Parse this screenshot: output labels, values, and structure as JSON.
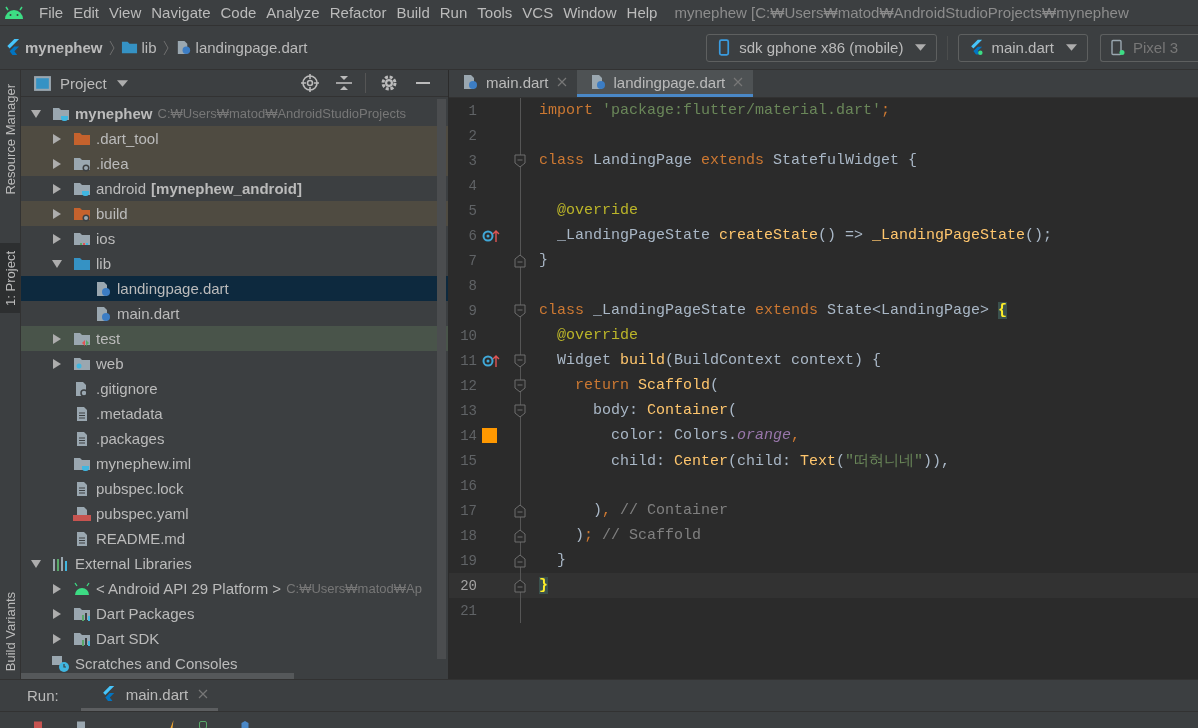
{
  "menu": [
    "File",
    "Edit",
    "View",
    "Navigate",
    "Code",
    "Analyze",
    "Refactor",
    "Build",
    "Run",
    "Tools",
    "VCS",
    "Window",
    "Help"
  ],
  "window": {
    "title": "mynephew [C:₩Users₩matod₩AndroidStudioProjects₩mynephew"
  },
  "breadcrumbs": [
    {
      "kind": "project",
      "label": "mynephew"
    },
    {
      "kind": "folder",
      "label": "lib"
    },
    {
      "kind": "file",
      "label": "landingpage.dart"
    }
  ],
  "toolbar": {
    "device": "sdk gphone x86 (mobile)",
    "run_config": "main.dart",
    "avd": "Pixel 3"
  },
  "side_tabs": [
    {
      "label": "Resource Manager",
      "selected": false
    },
    {
      "label": "1: Project",
      "selected": true
    }
  ],
  "side_tabs_bottom": [
    {
      "label": "Build Variants",
      "selected": false
    }
  ],
  "project_panel": {
    "title": "Project",
    "tree": [
      {
        "label": "mynephew",
        "kind": "project",
        "hint": "C:₩Users₩matod₩AndroidStudioProjects",
        "expanded": true,
        "selected": false,
        "children": [
          {
            "label": ".dart_tool",
            "kind": "excluded",
            "expanded": false,
            "selected": false
          },
          {
            "label": ".idea",
            "kind": "excluded-config",
            "expanded": false,
            "selected": false
          },
          {
            "label": "android",
            "suffix": "[mynephew_android]",
            "kind": "module",
            "expanded": false,
            "selected": false
          },
          {
            "label": "build",
            "kind": "excluded-build",
            "expanded": false,
            "selected": false
          },
          {
            "label": "ios",
            "kind": "platform",
            "expanded": false,
            "selected": false
          },
          {
            "label": "lib",
            "kind": "source",
            "expanded": true,
            "selected": false,
            "children": [
              {
                "label": "landingpage.dart",
                "kind": "dart",
                "selected": true
              },
              {
                "label": "main.dart",
                "kind": "dart",
                "selected": false
              }
            ]
          },
          {
            "label": "test",
            "kind": "test",
            "expanded": false,
            "selected": false
          },
          {
            "label": "web",
            "kind": "web",
            "expanded": false,
            "selected": false
          },
          {
            "label": ".gitignore",
            "kind": "ignore",
            "selected": false
          },
          {
            "label": ".metadata",
            "kind": "text",
            "selected": false
          },
          {
            "label": ".packages",
            "kind": "text",
            "selected": false
          },
          {
            "label": "mynephew.iml",
            "kind": "module",
            "selected": false
          },
          {
            "label": "pubspec.lock",
            "kind": "text",
            "selected": false
          },
          {
            "label": "pubspec.yaml",
            "kind": "yaml",
            "selected": false
          },
          {
            "label": "README.md",
            "kind": "text",
            "selected": false
          }
        ]
      },
      {
        "label": "External Libraries",
        "kind": "libraries",
        "expanded": true,
        "selected": false,
        "children": [
          {
            "label": "< Android API 29 Platform >",
            "kind": "android",
            "hint": "C:₩Users₩matod₩Ap",
            "expanded": false,
            "selected": false
          },
          {
            "label": "Dart Packages",
            "kind": "library",
            "expanded": false,
            "selected": false
          },
          {
            "label": "Dart SDK",
            "kind": "library",
            "expanded": false,
            "selected": false
          }
        ]
      },
      {
        "label": "Scratches and Consoles",
        "kind": "scratches",
        "selected": false
      }
    ]
  },
  "editor_tabs": [
    {
      "label": "main.dart",
      "selected": false
    },
    {
      "label": "landingpage.dart",
      "selected": true
    }
  ],
  "code_lines": [
    {
      "number": "1",
      "current": false,
      "fold_start": false,
      "fold_end": false,
      "overrides": false,
      "tokens": [
        {
          "kind": "keyword",
          "text": "import "
        },
        {
          "kind": "string",
          "text": "'package:flutter/material.dart'"
        },
        {
          "kind": "keyword",
          "text": ";"
        }
      ]
    },
    {
      "number": "2",
      "current": false,
      "fold_start": false,
      "fold_end": false,
      "overrides": false
    },
    {
      "number": "3",
      "current": false,
      "fold_start": true,
      "fold_end": false,
      "overrides": false,
      "tokens": [
        {
          "kind": "keyword",
          "text": "class "
        },
        {
          "kind": "plain",
          "text": "LandingPage "
        },
        {
          "kind": "keyword",
          "text": "extends "
        },
        {
          "kind": "plain",
          "text": "StatefulWidget {"
        }
      ]
    },
    {
      "number": "4",
      "current": false,
      "fold_start": false,
      "fold_end": false,
      "overrides": false
    },
    {
      "number": "5",
      "current": false,
      "fold_start": false,
      "fold_end": false,
      "overrides": false,
      "tokens": [
        {
          "kind": "annotation",
          "text": "  @override"
        }
      ]
    },
    {
      "number": "6",
      "current": false,
      "fold_start": false,
      "fold_end": false,
      "overrides": true,
      "tokens": [
        {
          "kind": "plain",
          "text": "  _LandingPageState "
        },
        {
          "kind": "function",
          "text": "createState"
        },
        {
          "kind": "plain",
          "text": "() => "
        },
        {
          "kind": "function",
          "text": "_LandingPageState"
        },
        {
          "kind": "plain",
          "text": "();"
        }
      ]
    },
    {
      "number": "7",
      "current": false,
      "fold_start": false,
      "fold_end": true,
      "overrides": false,
      "tokens": [
        {
          "kind": "plain",
          "text": "}"
        }
      ]
    },
    {
      "number": "8",
      "current": false,
      "fold_start": false,
      "fold_end": false,
      "overrides": false
    },
    {
      "number": "9",
      "current": false,
      "fold_start": true,
      "fold_end": false,
      "overrides": false,
      "tokens": [
        {
          "kind": "keyword",
          "text": "class "
        },
        {
          "kind": "plain",
          "text": "_LandingPageState "
        },
        {
          "kind": "keyword",
          "text": "extends "
        },
        {
          "kind": "plain",
          "text": "State<LandingPage> "
        },
        {
          "kind": "brace-match",
          "text": "{"
        }
      ]
    },
    {
      "number": "10",
      "current": false,
      "fold_start": false,
      "fold_end": false,
      "overrides": false,
      "tokens": [
        {
          "kind": "annotation",
          "text": "  @override"
        }
      ]
    },
    {
      "number": "11",
      "current": false,
      "fold_start": true,
      "fold_end": false,
      "overrides": true,
      "tokens": [
        {
          "kind": "plain",
          "text": "  Widget "
        },
        {
          "kind": "function",
          "text": "build"
        },
        {
          "kind": "plain",
          "text": "(BuildContext context) {"
        }
      ]
    },
    {
      "number": "12",
      "current": false,
      "fold_start": true,
      "fold_end": false,
      "overrides": false,
      "tokens": [
        {
          "kind": "keyword",
          "text": "    return "
        },
        {
          "kind": "function",
          "text": "Scaffold"
        },
        {
          "kind": "plain",
          "text": "("
        }
      ]
    },
    {
      "number": "13",
      "current": false,
      "fold_start": true,
      "fold_end": false,
      "overrides": false,
      "tokens": [
        {
          "kind": "plain",
          "text": "      body: "
        },
        {
          "kind": "function",
          "text": "Container"
        },
        {
          "kind": "plain",
          "text": "("
        }
      ]
    },
    {
      "number": "14",
      "current": false,
      "fold_start": false,
      "fold_end": false,
      "overrides": false,
      "color": "#ff9800",
      "tokens": [
        {
          "kind": "plain",
          "text": "        color: Colors."
        },
        {
          "kind": "constant",
          "text": "orange"
        },
        {
          "kind": "keyword",
          "text": ","
        }
      ]
    },
    {
      "number": "15",
      "current": false,
      "fold_start": false,
      "fold_end": false,
      "overrides": false,
      "tokens": [
        {
          "kind": "plain",
          "text": "        child: "
        },
        {
          "kind": "function",
          "text": "Center"
        },
        {
          "kind": "plain",
          "text": "(child: "
        },
        {
          "kind": "function",
          "text": "Text"
        },
        {
          "kind": "plain",
          "text": "("
        },
        {
          "kind": "string",
          "text": "\"떠혀니네\""
        },
        {
          "kind": "plain",
          "text": ")),"
        }
      ]
    },
    {
      "number": "16",
      "current": false,
      "fold_start": false,
      "fold_end": false,
      "overrides": false
    },
    {
      "number": "17",
      "current": false,
      "fold_start": false,
      "fold_end": true,
      "overrides": false,
      "tokens": [
        {
          "kind": "plain",
          "text": "      )"
        },
        {
          "kind": "keyword",
          "text": ", "
        },
        {
          "kind": "comment",
          "text": "// Container"
        }
      ]
    },
    {
      "number": "18",
      "current": false,
      "fold_start": false,
      "fold_end": true,
      "overrides": false,
      "tokens": [
        {
          "kind": "plain",
          "text": "    )"
        },
        {
          "kind": "keyword",
          "text": "; "
        },
        {
          "kind": "comment",
          "text": "// Scaffold"
        }
      ]
    },
    {
      "number": "19",
      "current": false,
      "fold_start": false,
      "fold_end": true,
      "overrides": false,
      "tokens": [
        {
          "kind": "plain",
          "text": "  }"
        }
      ]
    },
    {
      "number": "20",
      "current": true,
      "fold_start": false,
      "fold_end": true,
      "overrides": false,
      "tokens": [
        {
          "kind": "brace-match",
          "text": "}"
        }
      ]
    },
    {
      "number": "21",
      "current": false,
      "fold_start": false,
      "fold_end": false,
      "overrides": false
    }
  ],
  "run_bar": {
    "label": "Run:",
    "tabs": [
      {
        "label": "main.dart",
        "selected": true
      }
    ]
  }
}
